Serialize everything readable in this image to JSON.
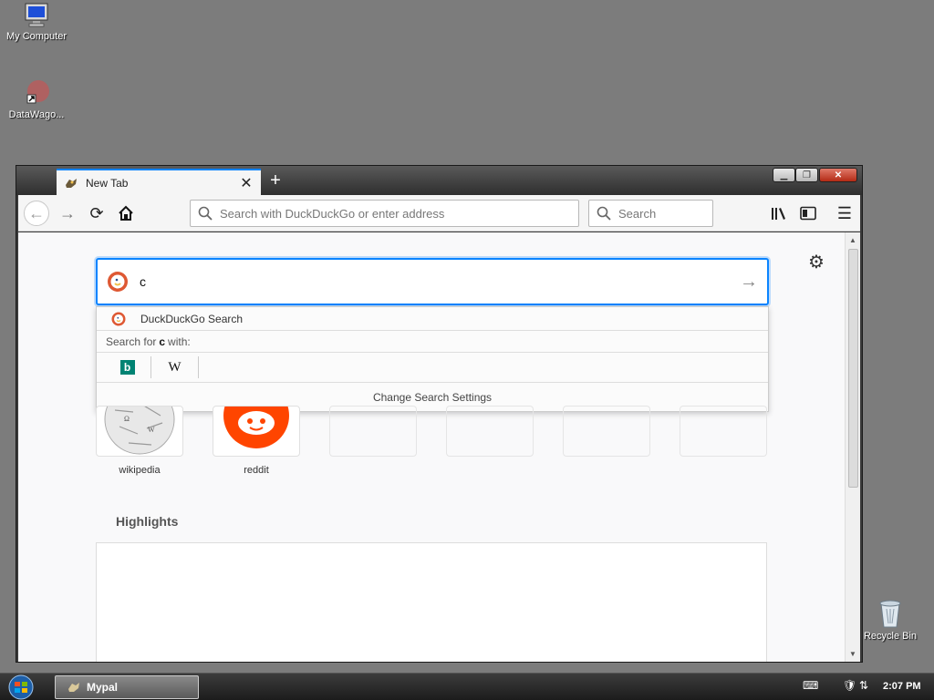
{
  "desktop": {
    "icons": [
      {
        "label": "My Computer",
        "icon": "computer-icon"
      },
      {
        "label": "DataWago...",
        "icon": "datawagon-icon"
      },
      {
        "label": "Recycle Bin",
        "icon": "recycle-bin-icon"
      }
    ]
  },
  "browser": {
    "tab": {
      "title": "New Tab",
      "close": "✕"
    },
    "toolbar": {
      "url_placeholder": "Search with DuckDuckGo or enter address",
      "search_placeholder": "Search"
    },
    "search": {
      "value": "c",
      "suggestion": "DuckDuckGo Search",
      "search_for_prefix": "Search for",
      "search_for_term": "c",
      "search_for_suffix": "with:",
      "engines": [
        {
          "name": "Bing",
          "glyph": "b"
        },
        {
          "name": "Wikipedia",
          "glyph": "W"
        }
      ],
      "change_settings": "Change Search Settings"
    },
    "top_sites": [
      {
        "label": "wikipedia"
      },
      {
        "label": "reddit"
      }
    ],
    "highlights_title": "Highlights"
  },
  "taskbar": {
    "task_label": "Mypal",
    "clock": "2:07 PM"
  },
  "colors": {
    "accent": "#0a84ff",
    "desktop": "#7c7c7c",
    "reddit": "#ff4500"
  }
}
